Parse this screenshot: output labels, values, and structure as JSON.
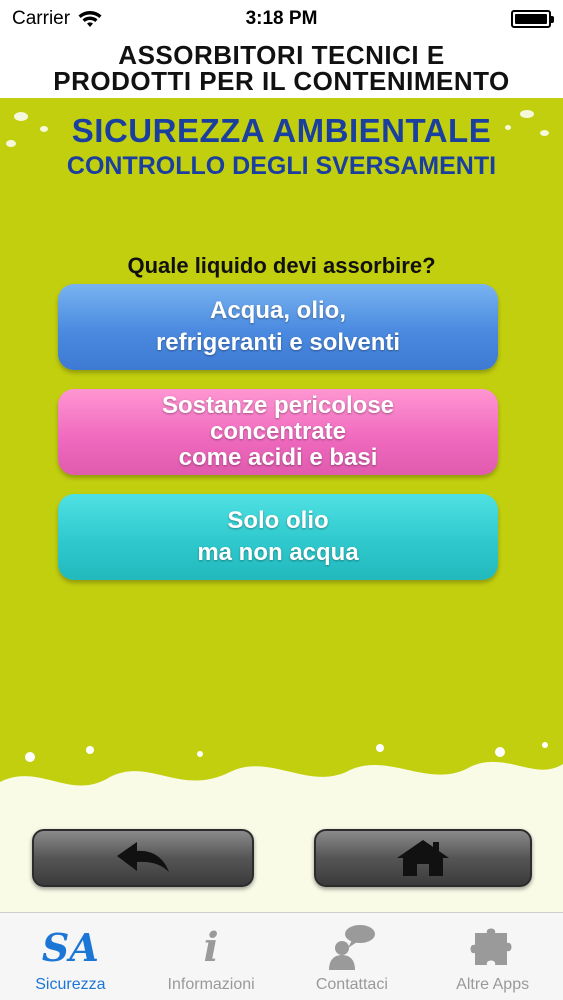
{
  "status_bar": {
    "carrier": "Carrier",
    "time": "3:18 PM",
    "icons": [
      "wifi-icon",
      "battery-icon"
    ]
  },
  "header": {
    "line1": "ASSORBITORI TECNICI E",
    "line2": "PRODOTTI PER IL CONTENIMENTO"
  },
  "title": {
    "main": "SICUREZZA AMBIENTALE",
    "sub": "CONTROLLO DEGLI SVERSAMENTI"
  },
  "question": "Quale liquido devi assorbire?",
  "choices": [
    {
      "line1": "Acqua, olio,",
      "line2": "refrigeranti e solventi",
      "color": "#4a8ae0"
    },
    {
      "line1": "Sostanze pericolose",
      "line2": "concentrate",
      "line3": "come acidi e basi",
      "color": "#f06bbf"
    },
    {
      "line1": "Solo olio",
      "line2": "ma non acqua",
      "color": "#2fc9cd"
    }
  ],
  "nav": {
    "back_icon": "back-arrow-icon",
    "home_icon": "home-icon"
  },
  "tabs": [
    {
      "label": "Sicurezza",
      "icon": "sa-logo-icon",
      "icon_text": "SA",
      "active": true
    },
    {
      "label": "Informazioni",
      "icon": "info-icon",
      "icon_text": "i",
      "active": false
    },
    {
      "label": "Contattaci",
      "icon": "contact-person-icon",
      "active": false
    },
    {
      "label": "Altre Apps",
      "icon": "puzzle-icon",
      "active": false
    }
  ],
  "colors": {
    "background": "#c2cf0f",
    "title_blue": "#1a3f9e",
    "tab_active": "#1c76d6",
    "tab_inactive": "#9a9a9a"
  }
}
